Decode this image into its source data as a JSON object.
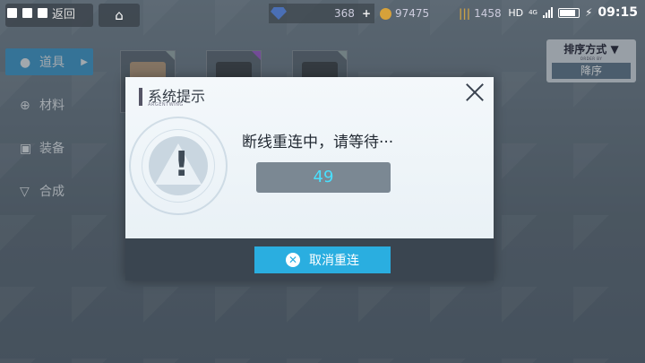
{
  "status_bar": {
    "network": "HD",
    "network_gen": "4G",
    "time": "09:15"
  },
  "top_bar": {
    "back_label": "返回",
    "gem_count": "368",
    "coin_count": "97475",
    "ammo_count": "1458",
    "icons": [
      "back-icon",
      "home-icon",
      "gem-icon",
      "coin-icon",
      "ammo-icon"
    ]
  },
  "sidebar": {
    "items": [
      {
        "label": "道具",
        "icon": "bag-icon",
        "active": true
      },
      {
        "label": "材料",
        "icon": "gear-icon",
        "active": false
      },
      {
        "label": "装备",
        "icon": "chest-icon",
        "active": false
      },
      {
        "label": "合成",
        "icon": "combine-icon",
        "active": false
      }
    ]
  },
  "sort": {
    "title": "排序方式",
    "subtitle": "ORDER BY",
    "value": "降序"
  },
  "dialog": {
    "title": "系统提示",
    "subtitle": "ARGENTWING",
    "message": "断线重连中，请等待···",
    "countdown": "49",
    "cancel_label": "取消重连"
  },
  "colors": {
    "accent": "#2aaee0",
    "active_tab": "#3d97c9",
    "countdown_text": "#49e0ff"
  }
}
